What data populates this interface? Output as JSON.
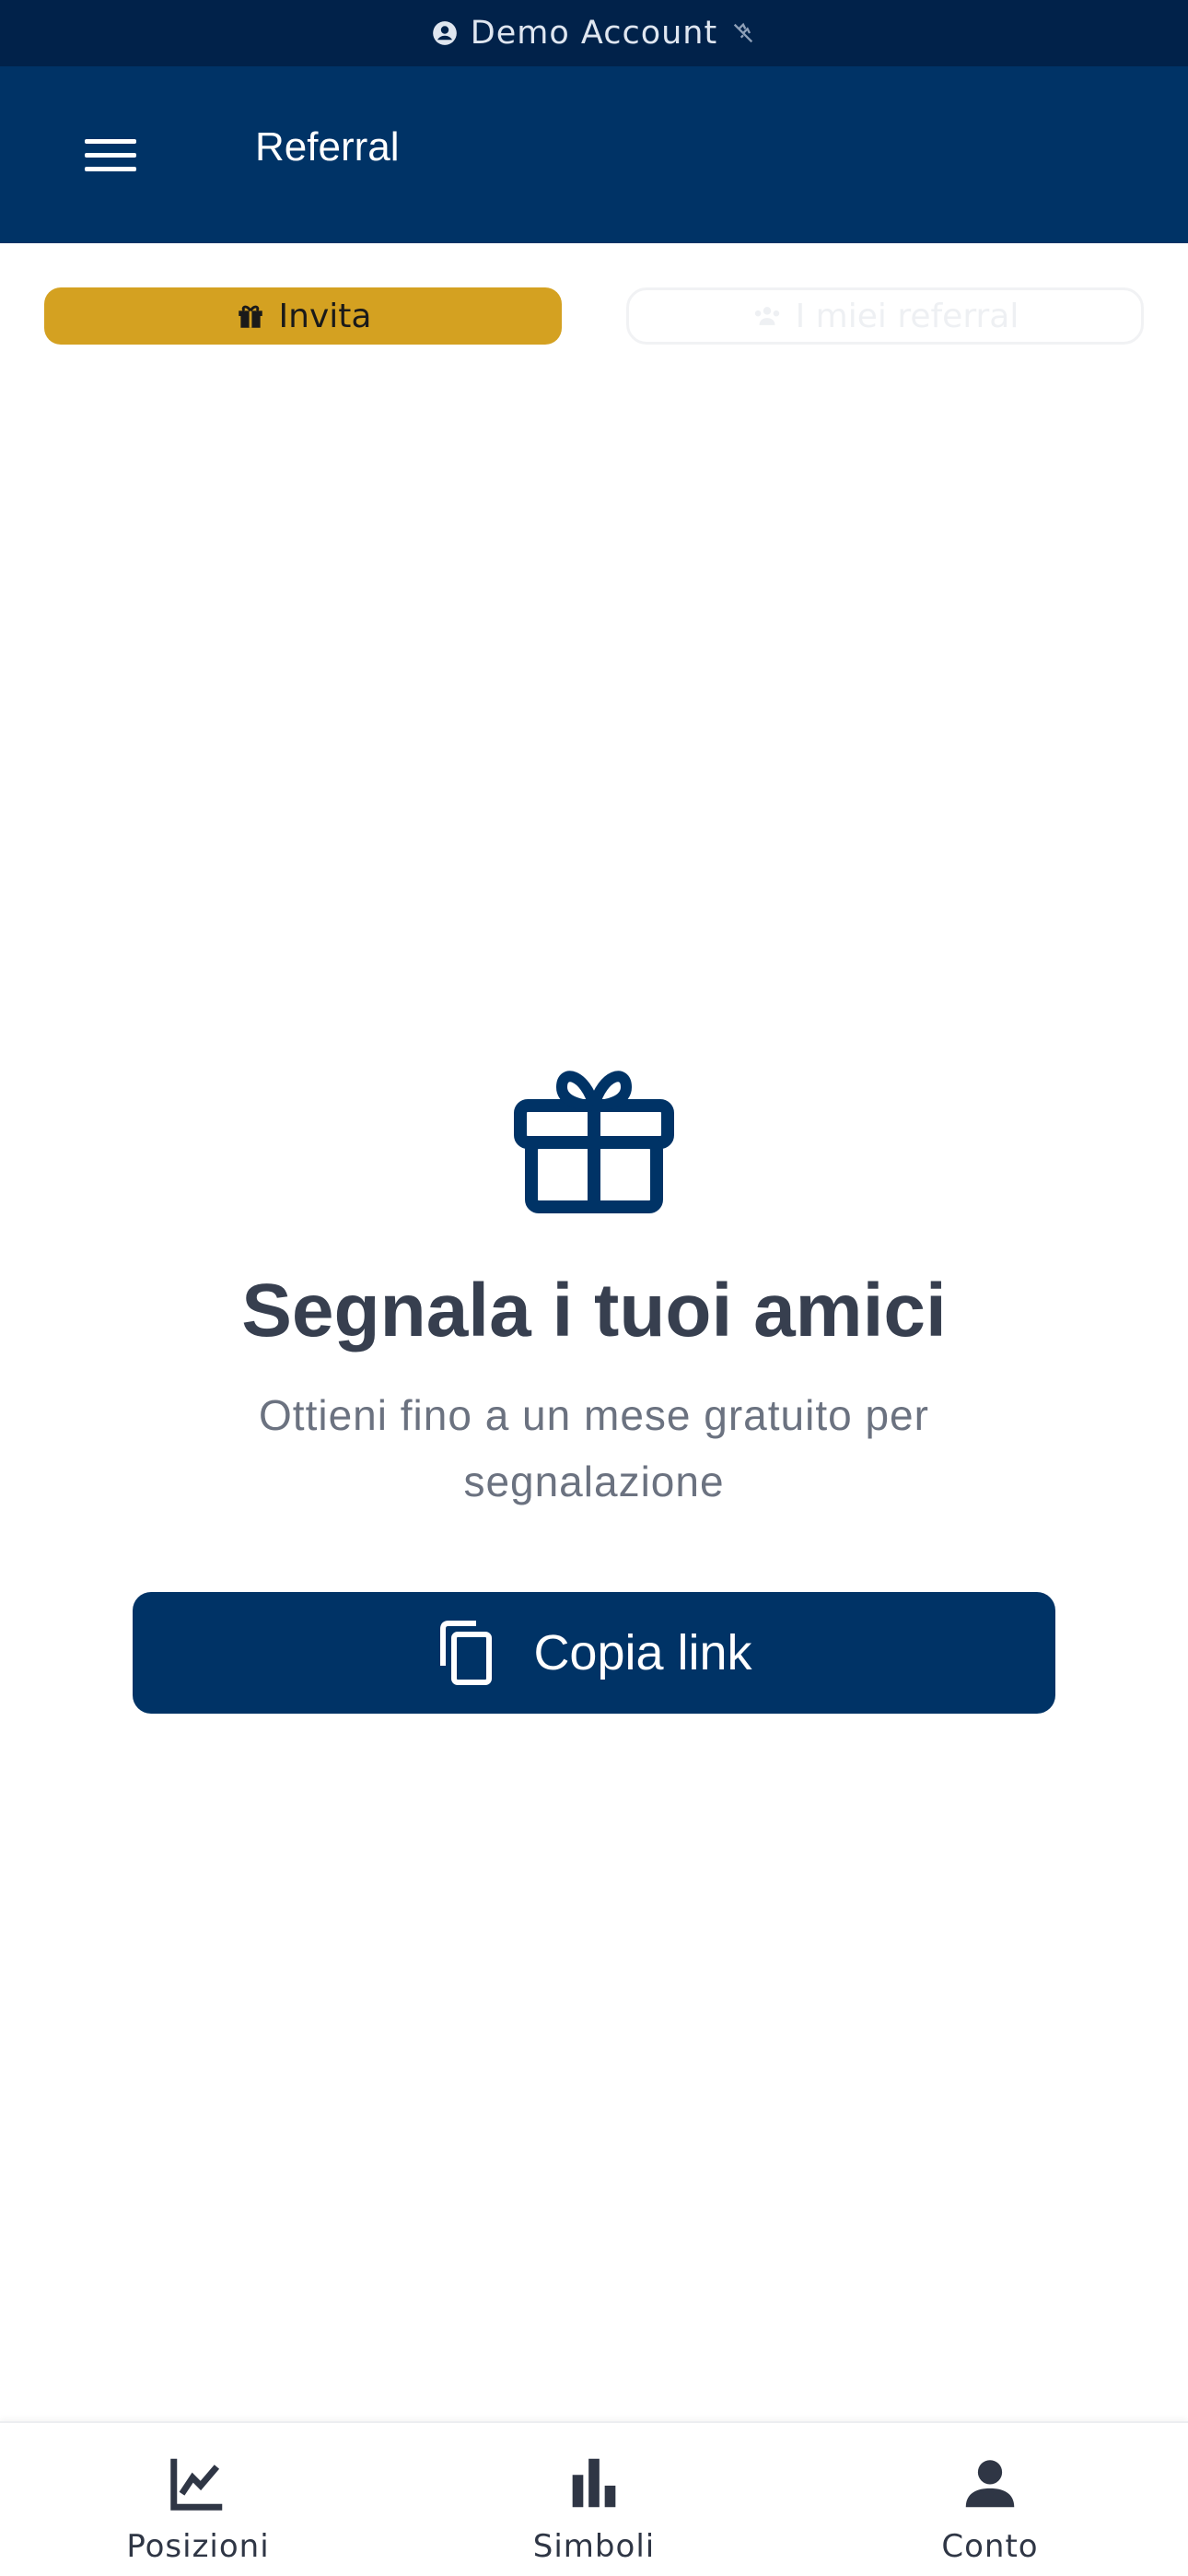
{
  "status_bar": {
    "account_label": "Demo Account"
  },
  "header": {
    "title": "Referral",
    "menu_icon": "hamburger-menu-icon"
  },
  "tabs": [
    {
      "label": "Invita",
      "icon": "gift-icon",
      "active": true,
      "active_color": "#d4a121"
    },
    {
      "label": "I miei referral",
      "icon": "users-icon",
      "active": false
    }
  ],
  "hero": {
    "icon": "gift-icon",
    "title": "Segnala i tuoi amici",
    "subtitle": "Ottieni fino a un mese gratuito per segnalazione"
  },
  "copy_button": {
    "label": "Copia link",
    "icon": "copy-icon"
  },
  "bottom_nav": [
    {
      "label": "Posizioni",
      "icon": "line-chart-icon"
    },
    {
      "label": "Simboli",
      "icon": "bar-chart-icon"
    },
    {
      "label": "Conto",
      "icon": "person-icon"
    }
  ],
  "colors": {
    "brand": "#003366",
    "status_bar": "#01224a",
    "accent": "#d4a121",
    "title_text": "#373f4f"
  }
}
